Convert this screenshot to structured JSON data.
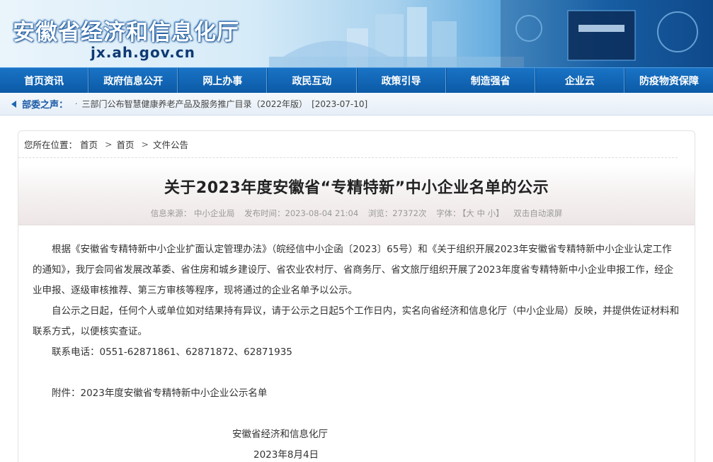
{
  "header": {
    "site_title": "安徽省经济和信息化厅",
    "site_domain": "jx.ah.gov.cn"
  },
  "nav": {
    "items": [
      "首页资讯",
      "政府信息公开",
      "网上办事",
      "政民互动",
      "政策引导",
      "制造强省",
      "企业云",
      "防疫物资保障"
    ]
  },
  "notice": {
    "label": "部委之声：",
    "text": "三部门公布智慧健康养老产品及服务推广目录（2022年版）",
    "date": "[2023-07-10]"
  },
  "breadcrumb": {
    "prefix": "您所在位置：",
    "items": [
      "首页",
      "首页",
      "文件公告"
    ]
  },
  "article": {
    "title": "关于2023年度安徽省“专精特新”中小企业名单的公示",
    "source": "信息来源：  中小企业局",
    "publish_time": "发布时间：2023-08-04 21:04",
    "views": "浏览：27372次",
    "font_label": "字体：",
    "font_sizes": "【大 中 小】",
    "autoscroll": "双击自动滚屏",
    "paragraph1": "根据《安徽省专精特新中小企业扩面认定管理办法》（皖经信中小企函〔2023〕65号）和《关于组织开展2023年安徽省专精特新中小企业认定工作的通知》，我厅会同省发展改革委、省住房和城乡建设厅、省农业农村厅、省商务厅、省文旅厅组织开展了2023年度省专精特新中小企业申报工作，经企业申报、逐级审核推荐、第三方审核等程序，现将通过的企业名单予以公示。",
    "paragraph2": "自公示之日起，任何个人或单位如对结果持有异议，请于公示之日起5个工作日内，实名向省经济和信息化厅（中小企业局）反映，并提供佐证材料和联系方式，以便核实查证。",
    "contact": "联系电话：0551-62871861、62871872、62871935",
    "attachment": "附件：2023年度安徽省专精特新中小企业公示名单",
    "signature": "安徽省经济和信息化厅",
    "date": "2023年8月4日"
  }
}
